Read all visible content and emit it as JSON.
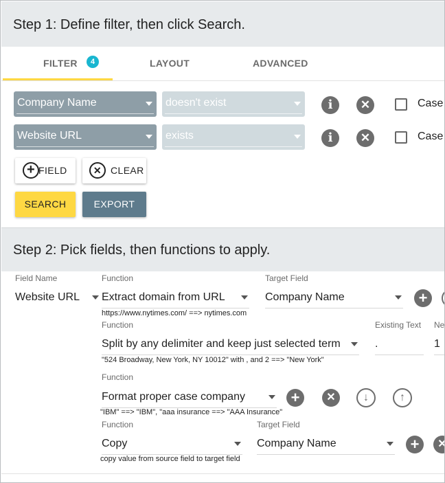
{
  "step1": {
    "title": "Step 1: Define filter, then click Search."
  },
  "tabs": [
    {
      "label": "FILTER",
      "badge": "4",
      "active": true
    },
    {
      "label": "LAYOUT"
    },
    {
      "label": "ADVANCED"
    }
  ],
  "filters": [
    {
      "field": "Company Name",
      "condition": "doesn't exist",
      "case_label": "Case"
    },
    {
      "field": "Website URL",
      "condition": "exists",
      "case_label": "Case"
    }
  ],
  "buttons": {
    "add_field": "FIELD",
    "clear": "CLEAR",
    "search": "SEARCH",
    "export": "EXPORT"
  },
  "step2": {
    "title": "Step 2: Pick fields, then functions to apply.",
    "field_name_label": "Field Name",
    "field_name_value": "Website URL",
    "functions": [
      {
        "function_label": "Function",
        "function_value": "Extract domain from URL",
        "target_label": "Target Field",
        "target_value": "Company Name",
        "hint": "https://www.nytimes.com/ ==> nytimes.com"
      },
      {
        "function_label": "Function",
        "function_value": "Split by any delimiter and keep just selected term",
        "existing_label": "Existing Text",
        "existing_value": ".",
        "new_label": "Ne",
        "new_value": "1",
        "hint": "\"524 Broadway, New York, NY 10012\" with , and 2 ==> \"New York\""
      },
      {
        "function_label": "Function",
        "function_value": "Format proper case company",
        "hint": "\"IBM\" ==> \"IBM\", \"aaa insurance ==> \"AAA Insurance\""
      },
      {
        "function_label": "Function",
        "function_value": "Copy",
        "target_label": "Target Field",
        "target_value": "Company Name",
        "hint": "copy value from source field to target field"
      }
    ]
  },
  "colors": {
    "accent": "#fed843",
    "slate": "#5e7b8c",
    "badge": "#19b6d0",
    "header_bg": "#e7eaec",
    "select_bg": "#8e9ea7"
  }
}
